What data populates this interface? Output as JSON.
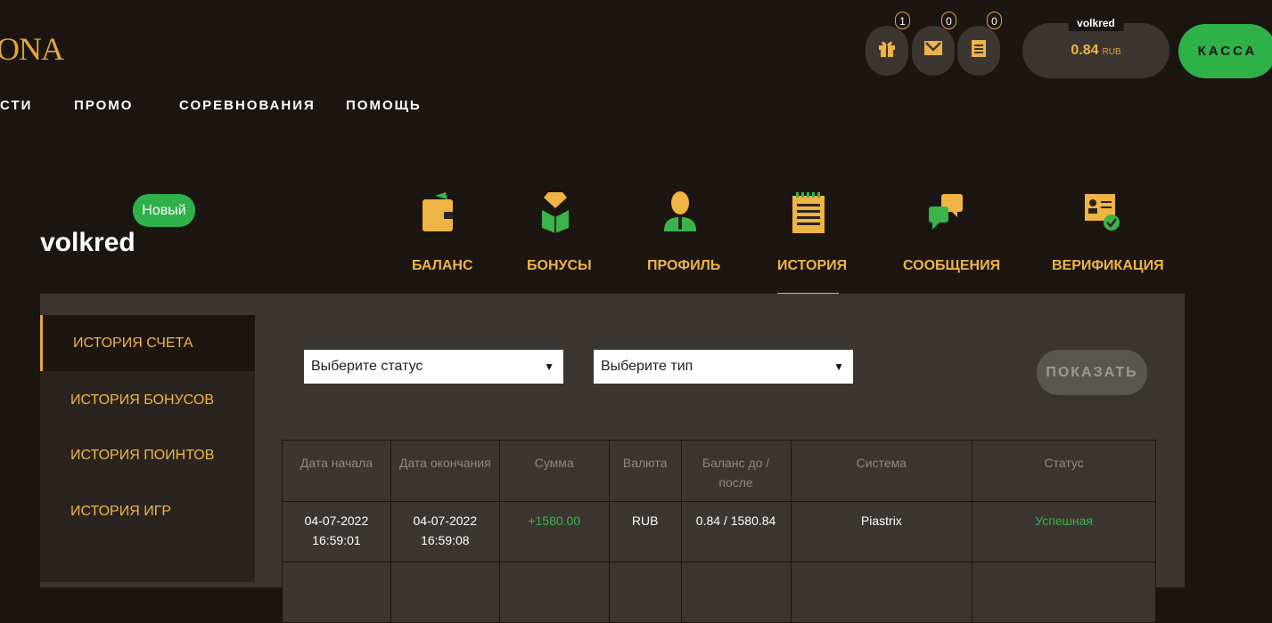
{
  "header": {
    "logo_text": "ONA",
    "nav": [
      "СТИ",
      "ПРОМО",
      "СОРЕВНОВАНИЯ",
      "ПОМОЩЬ"
    ],
    "icons": [
      {
        "name": "gift-icon",
        "count": "1"
      },
      {
        "name": "mail-icon",
        "count": "0"
      },
      {
        "name": "notes-icon",
        "count": "0"
      }
    ],
    "username": "volkred",
    "balance": "0.84",
    "currency": "RUB",
    "cashier_label": "КАССА"
  },
  "profile": {
    "status_badge": "Новый",
    "name": "volkred",
    "tabs": [
      {
        "label": "БАЛАНС",
        "icon": "wallet-icon"
      },
      {
        "label": "БОНУСЫ",
        "icon": "gift-box-icon"
      },
      {
        "label": "ПРОФИЛЬ",
        "icon": "user-icon"
      },
      {
        "label": "ИСТОРИЯ",
        "icon": "history-icon"
      },
      {
        "label": "СООБЩЕНИЯ",
        "icon": "chat-icon"
      },
      {
        "label": "ВЕРИФИКАЦИЯ",
        "icon": "id-card-icon"
      }
    ],
    "active_tab": "ИСТОРИЯ"
  },
  "sidebar": {
    "items": [
      "ИСТОРИЯ СЧЕТА",
      "ИСТОРИЯ БОНУСОВ",
      "ИСТОРИЯ ПОИНТОВ",
      "ИСТОРИЯ ИГР"
    ],
    "active": "ИСТОРИЯ СЧЕТА"
  },
  "filters": {
    "status_placeholder": "Выберите статус",
    "type_placeholder": "Выберите тип",
    "show_label": "ПОКАЗАТЬ"
  },
  "table": {
    "headers": [
      "Дата начала",
      "Дата окончания",
      "Сумма",
      "Валюта",
      "Баланс до / после",
      "Система",
      "Статус"
    ],
    "rows": [
      {
        "start": "04-07-2022 16:59:01",
        "end": "04-07-2022 16:59:08",
        "amount": "+1580.00",
        "currency": "RUB",
        "balance": "0.84 / 1580.84",
        "system": "Piastrix",
        "status": "Успешная"
      }
    ]
  },
  "colors": {
    "background": "#1c1613",
    "panel": "#3b3631",
    "accent": "#f0b444",
    "green": "#2fb14a"
  }
}
